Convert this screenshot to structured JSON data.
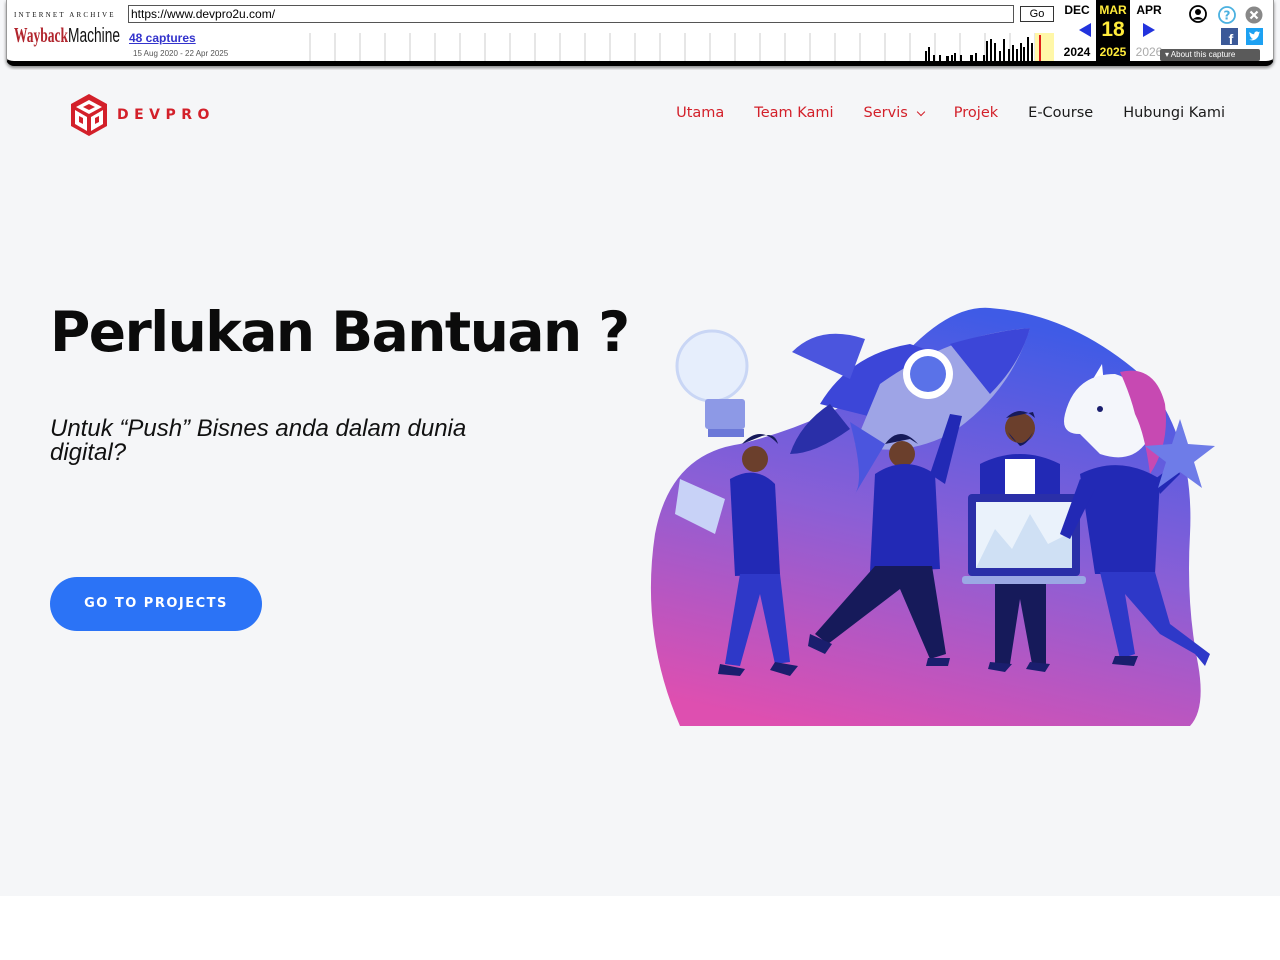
{
  "wayback": {
    "ia_label": "INTERNET ARCHIVE",
    "logo_text": "WaybackMachine",
    "url": "https://www.devpro2u.com/",
    "go_label": "Go",
    "captures_label": "48 captures",
    "date_range": "15 Aug 2020 - 22 Apr 2025",
    "prev_month": "DEC",
    "prev_year": "2024",
    "current_month": "MAR",
    "current_day": "18",
    "current_year": "2025",
    "next_month": "APR",
    "next_year": "2026",
    "about_label": "About this capture",
    "icons": [
      "user-icon",
      "help-icon",
      "close-icon",
      "facebook-icon",
      "twitter-icon"
    ]
  },
  "site": {
    "logo_text": "DEVPRO",
    "nav": [
      {
        "label": "Utama"
      },
      {
        "label": "Team Kami"
      },
      {
        "label": "Servis"
      },
      {
        "label": "Projek"
      },
      {
        "label": "E-Course"
      },
      {
        "label": "Hubungi Kami"
      }
    ],
    "hero": {
      "title": "Perlukan Bantuan ?",
      "subtitle": "Untuk “Push” Bisnes anda dalam dunia digital?",
      "cta_label": "GO TO PROJECTS"
    },
    "colors": {
      "brand_red": "#d3202a",
      "cta_blue": "#2b73f6",
      "blob_top": "#4b63e8",
      "blob_bottom": "#d653b4"
    }
  }
}
